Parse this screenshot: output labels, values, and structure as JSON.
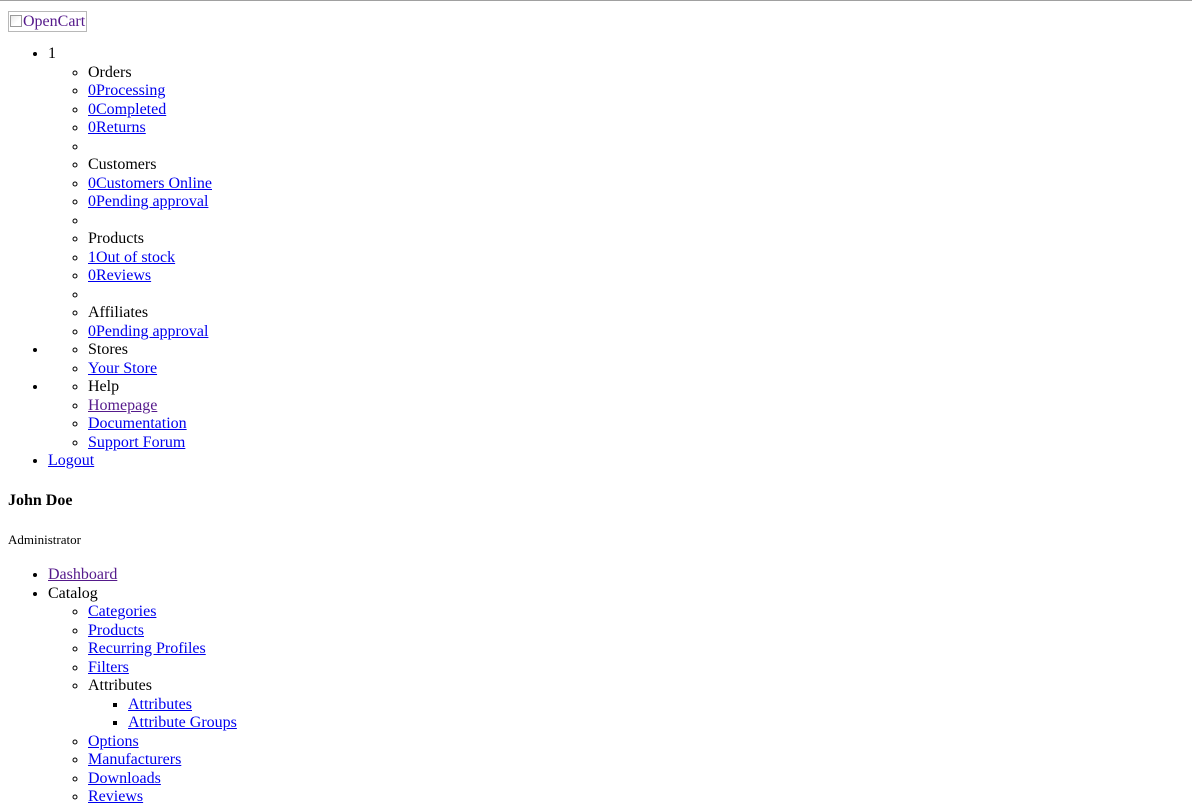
{
  "logo": {
    "alt": "OpenCart"
  },
  "header_nav": {
    "notification_count": "1",
    "orders": {
      "heading": "Orders",
      "items": [
        {
          "count": "0",
          "label": "Processing"
        },
        {
          "count": "0",
          "label": "Completed"
        },
        {
          "count": "0",
          "label": "Returns"
        }
      ]
    },
    "customers": {
      "heading": "Customers",
      "items": [
        {
          "count": "0",
          "label": "Customers Online"
        },
        {
          "count": "0",
          "label": "Pending approval"
        }
      ]
    },
    "products": {
      "heading": "Products",
      "items": [
        {
          "count": "1",
          "label": "Out of stock"
        },
        {
          "count": "0",
          "label": "Reviews"
        }
      ]
    },
    "affiliates": {
      "heading": "Affiliates",
      "items": [
        {
          "count": "0",
          "label": "Pending approval"
        }
      ]
    },
    "stores": {
      "heading": "Stores",
      "items": [
        "Your Store"
      ]
    },
    "help": {
      "heading": "Help",
      "items": [
        "Homepage",
        "Documentation",
        "Support Forum"
      ]
    },
    "logout": "Logout"
  },
  "profile": {
    "name": "John Doe",
    "role": "Administrator"
  },
  "menu": {
    "dashboard": " Dashboard",
    "catalog": {
      "heading": "Catalog",
      "items": {
        "categories": "Categories",
        "products": "Products",
        "recurring_profiles": "Recurring Profiles",
        "filters": "Filters",
        "attributes_heading": "Attributes",
        "attributes": "Attributes",
        "attribute_groups": "Attribute Groups",
        "options": "Options",
        "manufacturers": "Manufacturers",
        "downloads": "Downloads",
        "reviews": "Reviews"
      }
    }
  },
  "colors": {
    "link": "#0000ee",
    "visited_link": "#551a8b",
    "text": "#000000",
    "background": "#ffffff"
  }
}
